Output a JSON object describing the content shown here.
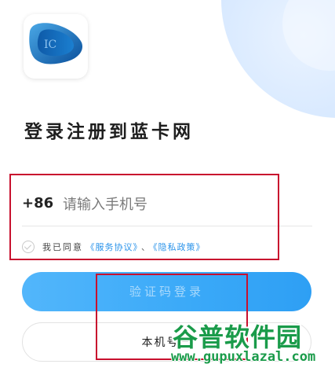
{
  "app": {
    "logo_text": "IC",
    "title": "登录注册到蓝卡网"
  },
  "phone": {
    "country_code": "+86",
    "placeholder": "请输入手机号",
    "value": ""
  },
  "agreement": {
    "prefix": "我已同意",
    "service_link": "《服务协议》",
    "separator": "、",
    "privacy_link": "《隐私政策》",
    "checked": false
  },
  "buttons": {
    "sms_login": "验证码登录",
    "local_login": "本机号一"
  },
  "watermark": {
    "cn": "谷普软件园",
    "url": "www.gupuxlazal.com"
  },
  "colors": {
    "primary": "#3aa9f8",
    "link": "#2a93ea",
    "annotation": "#c8102e",
    "watermark": "#1a9b4a"
  }
}
